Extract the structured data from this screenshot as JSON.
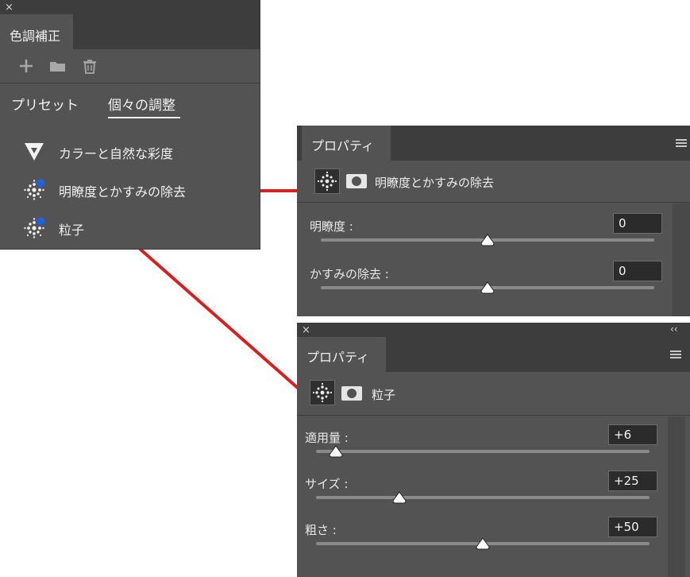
{
  "adjustments_panel": {
    "close_glyph": "×",
    "tab_label": "色調補正",
    "toolbar": {
      "add_icon": "plus-icon",
      "folder_icon": "folder-icon",
      "trash_icon": "trash-icon"
    },
    "segments": [
      {
        "label": "プリセット",
        "selected": false
      },
      {
        "label": "個々の調整",
        "selected": true
      }
    ],
    "items": [
      {
        "label": "カラーと自然な彩度",
        "icon": "vibrance-triangle-icon"
      },
      {
        "label": "明瞭度とかすみの除去",
        "icon": "clarity-dots-icon"
      },
      {
        "label": "粒子",
        "icon": "grain-dots-icon"
      }
    ]
  },
  "properties_clarity": {
    "tab_label": "プロパティ",
    "title": "明瞭度とかすみの除去",
    "fields": [
      {
        "label": "明瞭度 :",
        "value": "0",
        "level": 0.5
      },
      {
        "label": "かすみの除去 :",
        "value": "0",
        "level": 0.5
      }
    ]
  },
  "properties_grain": {
    "close_glyph": "×",
    "collapse_glyph": "‹‹",
    "tab_label": "プロパティ",
    "title": "粒子",
    "fields": [
      {
        "label": "適用量 :",
        "value": "+6",
        "level": 0.06
      },
      {
        "label": "サイズ :",
        "value": "+25",
        "level": 0.25
      },
      {
        "label": "粗さ :",
        "value": "+50",
        "level": 0.5
      }
    ]
  },
  "colors": {
    "panel": "#535353",
    "tabbar": "#3d3d3d",
    "accent_blue": "#1d63e6",
    "connector_red": "#d81e1e"
  }
}
